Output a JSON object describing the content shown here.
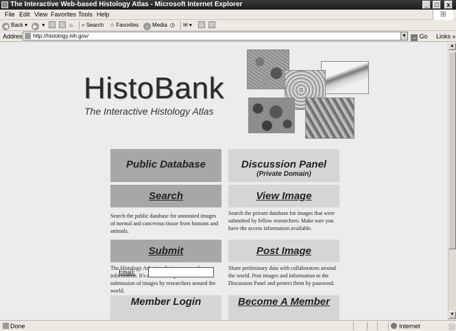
{
  "window": {
    "title": "The Interactive Web-based Histology Atlas - Microsoft Internet Explorer",
    "minimize": "_",
    "maximize": "□",
    "close": "x"
  },
  "menu": [
    "File",
    "Edit",
    "View",
    "Favorites",
    "Tools",
    "Help"
  ],
  "toolbar": {
    "back": "Back",
    "search": "Search",
    "favorites": "Favorites",
    "media": "Media"
  },
  "address": {
    "label": "Address",
    "url": "http://histology.nih.gov/",
    "go": "Go",
    "links": "Links"
  },
  "page": {
    "logo_title": "HistoBank",
    "logo_subtitle": "The Interactive Histology Atlas",
    "panels": {
      "public_database": "Public Database",
      "discussion_panel": "Discussion Panel",
      "discussion_sub": "(Private Domain)",
      "search": "Search",
      "view_image": "View Image",
      "submit": "Submit",
      "post_image": "Post Image",
      "member_login": "Member Login",
      "become_member": "Become A Member"
    },
    "descriptions": {
      "search": "Search the public database for annotated images of normal and cancerous tissue from humans and animals.",
      "view_image": "Search the private database for images that were submitted by fellow researchers. Make sure you have the access information available.",
      "submit": "The Histology Atlas is a living source of information. It's existence depends on the submission of images by researchers around the world.",
      "post_image": "Share preliminary data with collaborators around the world. Post images and information to the Discussion Panel and protect them by password."
    },
    "email_label": "Email:"
  },
  "status": {
    "text": "Done",
    "zone": "Internet"
  }
}
